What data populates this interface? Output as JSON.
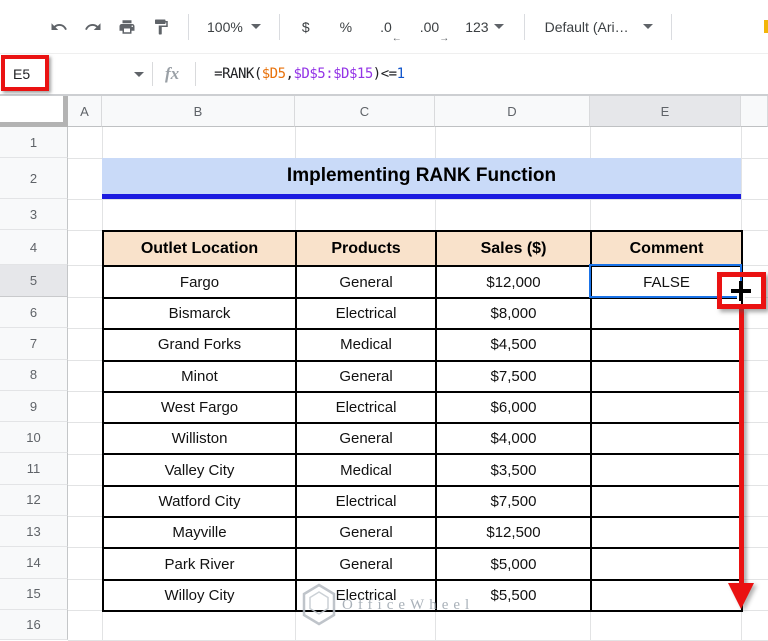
{
  "toolbar": {
    "zoom": "100%",
    "currency": "$",
    "percent": "%",
    "decrease_decimal": ".0",
    "increase_decimal": ".00",
    "more_formats": "123",
    "font": "Default (Ari…"
  },
  "formula_bar": {
    "name_box": "E5",
    "fx": "fx",
    "formula_segments": [
      {
        "text": "=RANK(",
        "color": "#202124"
      },
      {
        "text": "$D5",
        "color": "#e8710a"
      },
      {
        "text": ",",
        "color": "#202124"
      },
      {
        "text": "$D$5:$D$15",
        "color": "#9334e6"
      },
      {
        "text": ")<=",
        "color": "#202124"
      },
      {
        "text": "1",
        "color": "#1155cb"
      }
    ]
  },
  "sheet": {
    "columns": [
      "A",
      "B",
      "C",
      "D",
      "E"
    ],
    "row_numbers": [
      1,
      2,
      3,
      4,
      5,
      6,
      7,
      8,
      9,
      10,
      11,
      12,
      13,
      14,
      15,
      16
    ],
    "selected_cell": "E5",
    "selected_column": "E",
    "selected_row": 5,
    "title": "Implementing RANK Function",
    "table": {
      "headers": [
        "Outlet Location",
        "Products",
        "Sales ($)",
        "Comment"
      ],
      "rows": [
        [
          "Fargo",
          "General",
          "$12,000",
          "FALSE"
        ],
        [
          "Bismarck",
          "Electrical",
          "$8,000",
          ""
        ],
        [
          "Grand Forks",
          "Medical",
          "$4,500",
          ""
        ],
        [
          "Minot",
          "General",
          "$7,500",
          ""
        ],
        [
          "West Fargo",
          "Electrical",
          "$6,000",
          ""
        ],
        [
          "Williston",
          "General",
          "$4,000",
          ""
        ],
        [
          "Valley City",
          "Medical",
          "$3,500",
          ""
        ],
        [
          "Watford City",
          "Electrical",
          "$7,500",
          ""
        ],
        [
          "Mayville",
          "General",
          "$12,500",
          ""
        ],
        [
          "Park River",
          "General",
          "$5,000",
          ""
        ],
        [
          "Willoy City",
          "Electrical",
          "$5,500",
          ""
        ]
      ]
    },
    "watermark": "OfficeWheel"
  },
  "colors": {
    "title_bg": "#c9daf8",
    "title_border": "#1b1be0",
    "table_header_bg": "#f9e2cb",
    "selection_border": "#1a73e8",
    "annotation_red": "#ea1212"
  }
}
